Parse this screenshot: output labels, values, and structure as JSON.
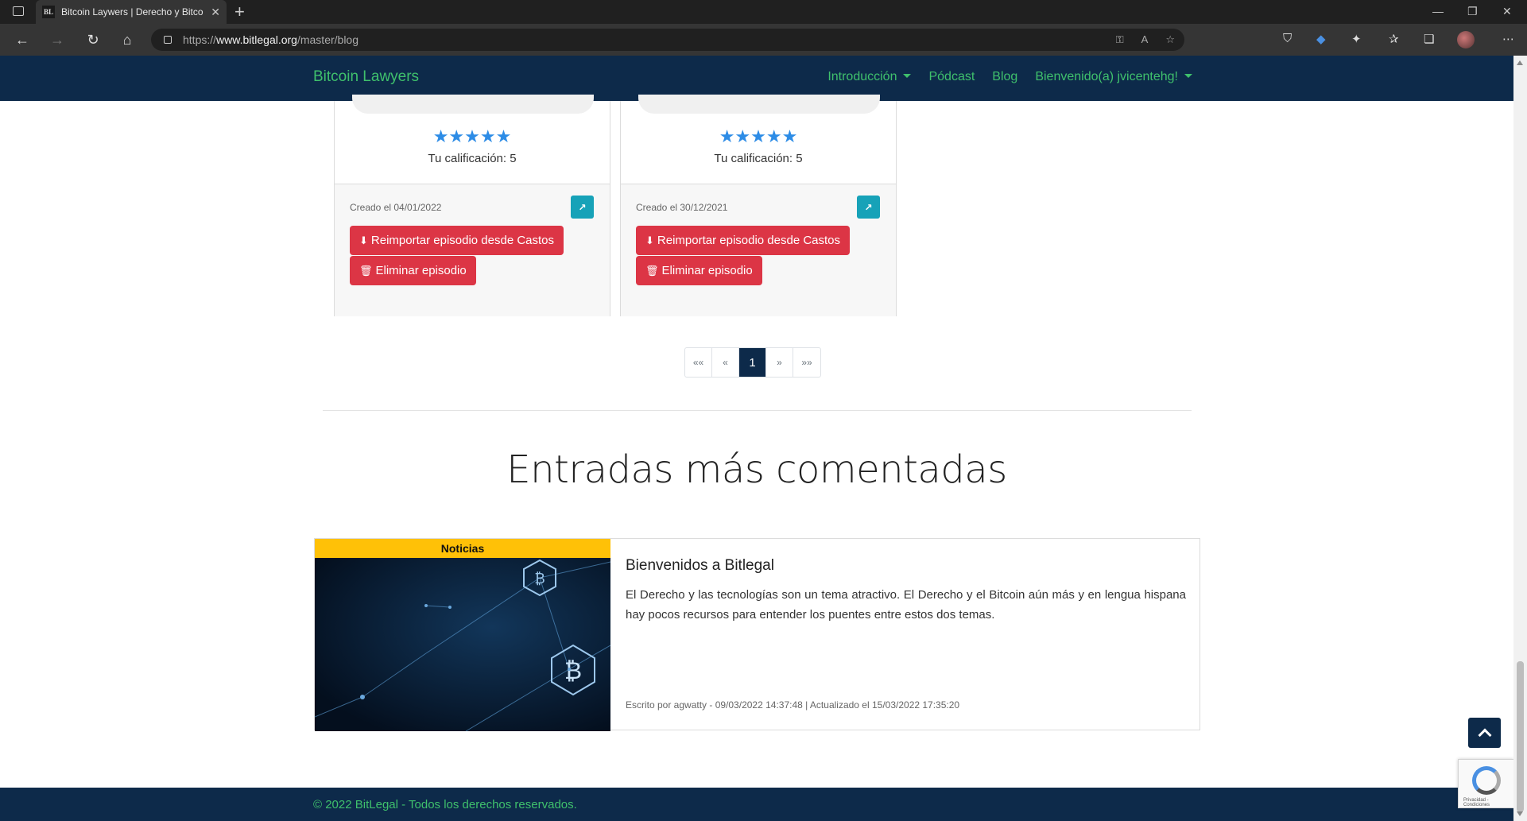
{
  "browser": {
    "tab_title": "Bitcoin Laywers | Derecho y Bitco",
    "favicon_text": "BL",
    "url_prefix": "https://",
    "url_domain": "www.bitlegal.org",
    "url_path": "/master/blog"
  },
  "site": {
    "brand": "Bitcoin Lawyers",
    "nav": {
      "intro": "Introducción",
      "podcast": "Pódcast",
      "blog": "Blog",
      "user": "Bienvenido(a) jvicentehg!"
    }
  },
  "episodes": [
    {
      "stars": "★★★★★",
      "rating_text": "Tu calificación: 5",
      "created": "Creado el 04/01/2022",
      "reimport_label": "Reimportar episodio desde Castos",
      "delete_label": "Eliminar episodio"
    },
    {
      "stars": "★★★★★",
      "rating_text": "Tu calificación: 5",
      "created": "Creado el 30/12/2021",
      "reimport_label": "Reimportar episodio desde Castos",
      "delete_label": "Eliminar episodio"
    }
  ],
  "pagination": {
    "first": "««",
    "prev": "«",
    "current": "1",
    "next": "»",
    "last": "»»"
  },
  "most_commented": {
    "title": "Entradas más comentadas",
    "post": {
      "category": "Noticias",
      "title": "Bienvenidos a Bitlegal",
      "excerpt": "El Derecho y las tecnologías son un tema atractivo. El Derecho y el Bitcoin aún más y en lengua hispana hay pocos recursos para entender los puentes entre estos dos temas.",
      "meta": "Escrito por agwatty - 09/03/2022 14:37:48 | Actualizado el 15/03/2022 17:35:20"
    }
  },
  "footer": {
    "text": "© 2022 BitLegal - Todos los derechos reservados."
  },
  "recaptcha": {
    "text": "Privacidad - Condiciones"
  },
  "colors": {
    "navy": "#0d2a4a",
    "green": "#3fc06c",
    "danger": "#dc3545",
    "info": "#17a2b8",
    "warning": "#ffc107",
    "star": "#2d8ce6"
  }
}
